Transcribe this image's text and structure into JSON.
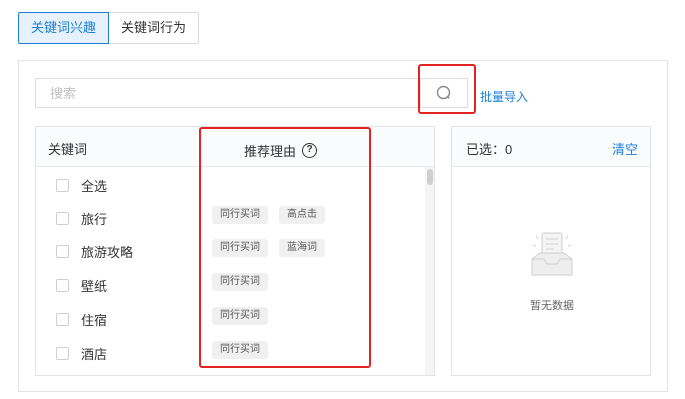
{
  "tabs": [
    {
      "label": "关键词兴趣",
      "active": true
    },
    {
      "label": "关键词行为",
      "active": false
    }
  ],
  "search": {
    "placeholder": "搜索",
    "value": ""
  },
  "batch_import_label": "批量导入",
  "keyword_panel": {
    "keyword_header": "关键词",
    "reason_header": "推荐理由",
    "help_glyph": "?",
    "rows": [
      {
        "label": "全选",
        "checked": false,
        "tags": []
      },
      {
        "label": "旅行",
        "checked": false,
        "tags": [
          "同行买词",
          "高点击"
        ]
      },
      {
        "label": "旅游攻略",
        "checked": false,
        "tags": [
          "同行买词",
          "蓝海词"
        ]
      },
      {
        "label": "壁纸",
        "checked": false,
        "tags": [
          "同行买词"
        ]
      },
      {
        "label": "住宿",
        "checked": false,
        "tags": [
          "同行买词"
        ]
      },
      {
        "label": "酒店",
        "checked": false,
        "tags": [
          "同行买词"
        ]
      }
    ]
  },
  "selected_panel": {
    "selected_label": "已选：0",
    "clear_label": "清空",
    "empty_text": "暂无数据"
  },
  "colors": {
    "accent": "#1e7fd6",
    "highlight_box": "#e32222"
  }
}
